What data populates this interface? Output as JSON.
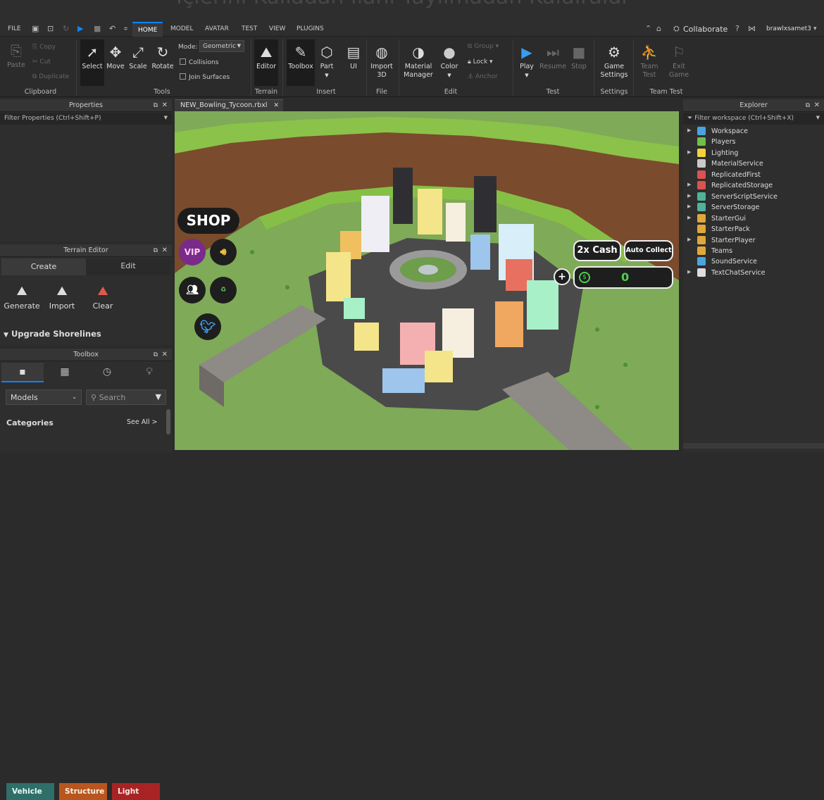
{
  "overlay_text": "İçlerini Kulladan İlani Yayılmadan Kaldıraldı",
  "menu": {
    "file": "FILE",
    "tabs": [
      "HOME",
      "MODEL",
      "AVATAR",
      "TEST",
      "VIEW",
      "PLUGINS"
    ],
    "collaborate": "Collaborate",
    "user": "brawlxsamet3"
  },
  "ribbon": {
    "clipboard": {
      "paste": "Paste",
      "copy": "Copy",
      "cut": "Cut",
      "duplicate": "Duplicate",
      "group": "Clipboard"
    },
    "tools": {
      "select": "Select",
      "move": "Move",
      "scale": "Scale",
      "rotate": "Rotate",
      "mode_label": "Mode:",
      "mode_value": "Geometric",
      "collisions": "Collisions",
      "join_surfaces": "Join Surfaces",
      "group": "Tools"
    },
    "terrain": {
      "editor": "Editor",
      "group": "Terrain"
    },
    "insert": {
      "toolbox": "Toolbox",
      "part": "Part",
      "ui": "UI",
      "group": "Insert"
    },
    "file": {
      "import3d_line1": "Import",
      "import3d_line2": "3D",
      "group": "File"
    },
    "edit": {
      "material_line1": "Material",
      "material_line2": "Manager",
      "color": "Color",
      "group_btn": "Group",
      "lock": "Lock",
      "anchor": "Anchor",
      "group": "Edit"
    },
    "test": {
      "play": "Play",
      "resume": "Resume",
      "stop": "Stop",
      "group": "Test"
    },
    "settings": {
      "line1": "Game",
      "line2": "Settings",
      "group": "Settings"
    },
    "team_test": {
      "team_line1": "Team",
      "team_line2": "Test",
      "exit_line1": "Exit",
      "exit_line2": "Game",
      "group": "Team Test"
    }
  },
  "properties": {
    "title": "Properties",
    "filter": "Filter Properties (Ctrl+Shift+P)"
  },
  "terrain_editor": {
    "title": "Terrain Editor",
    "tabs": [
      "Create",
      "Edit"
    ],
    "actions": [
      "Generate",
      "Import",
      "Clear"
    ],
    "section": "Upgrade Shorelines"
  },
  "toolbox": {
    "title": "Toolbox",
    "dropdown": "Models",
    "search_placeholder": "Search",
    "categories_label": "Categories",
    "see_all": "See All >",
    "categories": [
      {
        "label": "Vehicle",
        "color": "#2f6f6a"
      },
      {
        "label": "Structure",
        "color": "#b8561f"
      },
      {
        "label": "Light",
        "color": "#a82424"
      }
    ]
  },
  "document_tab": "NEW_Bowling_Tycoon.rbxl",
  "game_ui": {
    "shop": "SHOP",
    "vip": "VIP",
    "cash2x": "2x Cash",
    "auto_collect": "Auto Collect",
    "cash_value": "0",
    "plus": "+"
  },
  "explorer": {
    "title": "Explorer",
    "filter": "Filter workspace (Ctrl+Shift+X)",
    "items": [
      {
        "label": "Workspace",
        "expandable": true,
        "color": "#4aa3df"
      },
      {
        "label": "Players",
        "expandable": false,
        "color": "#6fbf4a"
      },
      {
        "label": "Lighting",
        "expandable": true,
        "color": "#f2d13b"
      },
      {
        "label": "MaterialService",
        "expandable": false,
        "color": "#c9c9c9"
      },
      {
        "label": "ReplicatedFirst",
        "expandable": false,
        "color": "#d9534f"
      },
      {
        "label": "ReplicatedStorage",
        "expandable": true,
        "color": "#d9534f"
      },
      {
        "label": "ServerScriptService",
        "expandable": true,
        "color": "#4fb39a"
      },
      {
        "label": "ServerStorage",
        "expandable": true,
        "color": "#4fb39a"
      },
      {
        "label": "StarterGui",
        "expandable": true,
        "color": "#e0a83a"
      },
      {
        "label": "StarterPack",
        "expandable": false,
        "color": "#e0a83a"
      },
      {
        "label": "StarterPlayer",
        "expandable": true,
        "color": "#e0a83a"
      },
      {
        "label": "Teams",
        "expandable": false,
        "color": "#e0a83a"
      },
      {
        "label": "SoundService",
        "expandable": false,
        "color": "#4aa3df"
      },
      {
        "label": "TextChatService",
        "expandable": true,
        "color": "#dddddd"
      }
    ]
  }
}
